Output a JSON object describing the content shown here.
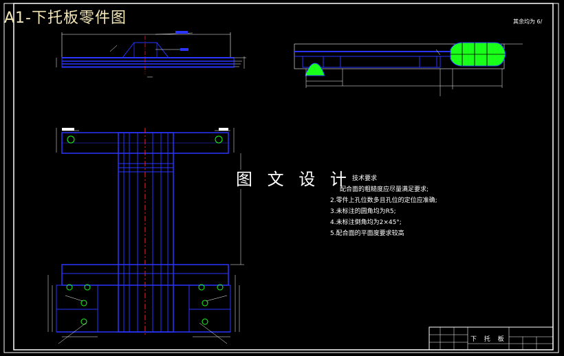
{
  "drawing_title": "A1-下托板零件图",
  "surface_note": "其余均为 6/",
  "watermark": "图 文 设 计",
  "technical_requirements": {
    "heading": "技术要求",
    "items": [
      "配合面的粗糙度应尽量满足要求;",
      "2.零件上孔位数多且孔位的定位应准确;",
      "3.未标注的圆角均为R5;",
      "4.未标注倒角均为2×45°;",
      "5.配合面的平面度要求较高"
    ]
  },
  "title_block": {
    "part_name": "下 托 板"
  },
  "colors": {
    "background": "#000000",
    "frame": "#ffffff",
    "outline": "#2a35ff",
    "centerline": "#ff2020",
    "dimension": "#ffffff",
    "fill_green": "#19ff19"
  }
}
